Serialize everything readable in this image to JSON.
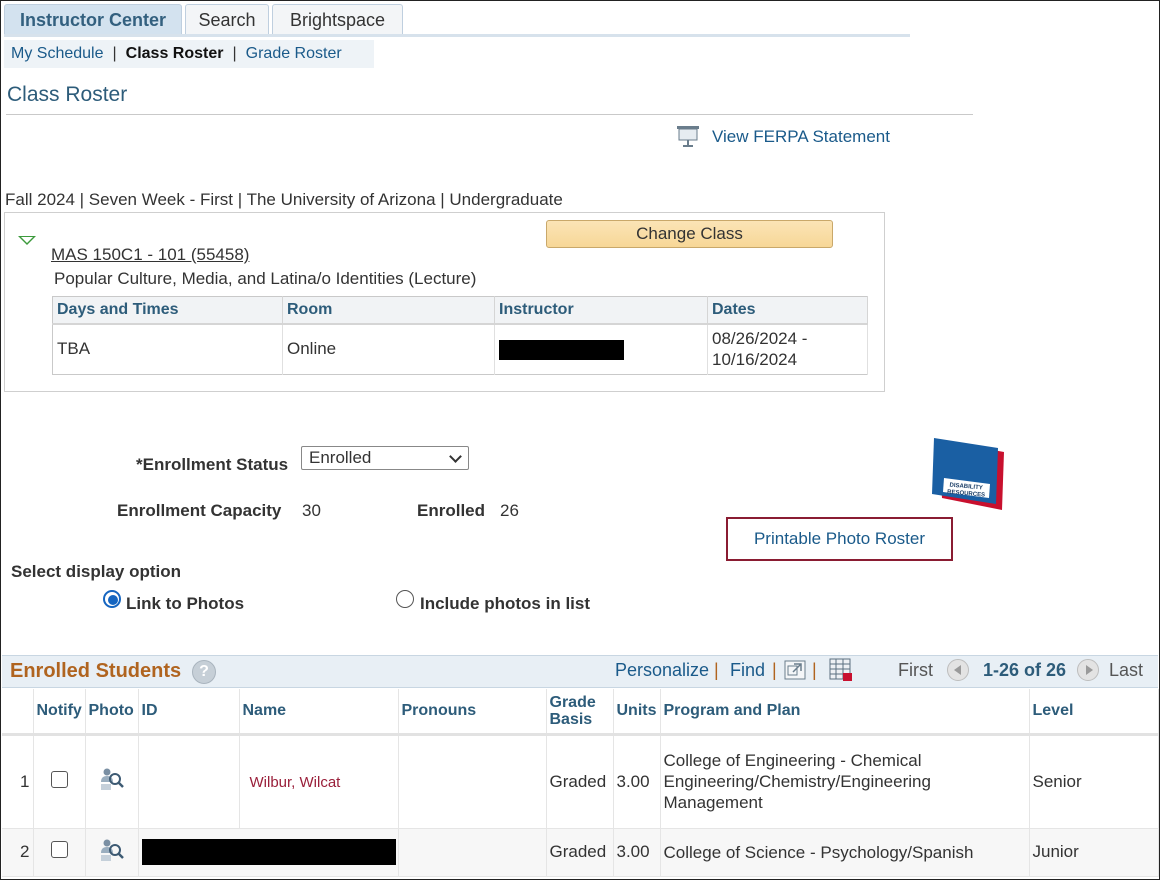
{
  "tabs": [
    {
      "label": "Instructor Center",
      "active": true
    },
    {
      "label": "Search",
      "active": false
    },
    {
      "label": "Brightspace",
      "active": false
    }
  ],
  "subnav": {
    "my_schedule": "My Schedule",
    "class_roster": "Class Roster",
    "grade_roster": "Grade Roster",
    "separator": "|"
  },
  "page_title": "Class Roster",
  "ferpa_link": "View FERPA Statement",
  "term_line": "Fall 2024 | Seven Week - First | The University of Arizona | Undergraduate",
  "change_class_label": "Change Class",
  "class": {
    "code": "MAS 150C1 - 101 (55458)",
    "description": "Popular Culture, Media, and Latina/o Identities (Lecture)",
    "headers": [
      "Days and Times",
      "Room",
      "Instructor",
      "Dates"
    ],
    "days_times": "TBA",
    "room": "Online",
    "dates_start": "08/26/2024 -",
    "dates_end": "10/16/2024"
  },
  "enrollment": {
    "status_label": "*Enrollment Status",
    "status_value": "Enrolled",
    "capacity_label": "Enrollment Capacity",
    "capacity_value": "30",
    "enrolled_label": "Enrolled",
    "enrolled_value": "26"
  },
  "logo_text": {
    "line1": "DISABILITY",
    "line2": "RESOURCES"
  },
  "printable_photo_roster": "Printable Photo Roster",
  "display_option": {
    "label": "Select display option",
    "link_to_photos": "Link to Photos",
    "include_photos": "Include photos in list",
    "selected": "Link to Photos"
  },
  "grid": {
    "title": "Enrolled Students",
    "help": "?",
    "personalize": "Personalize",
    "find": "Find",
    "sep": "|",
    "first": "First",
    "range": "1-26 of 26",
    "last": "Last",
    "columns": [
      "Notify",
      "Photo",
      "ID",
      "Name",
      "Pronouns",
      "Grade Basis",
      "Units",
      "Program and Plan",
      "Level"
    ],
    "rows": [
      {
        "num": "1",
        "name": "Wilbur, Wilcat",
        "basis": "Graded",
        "units": "3.00",
        "program": "College of Engineering - Chemical Engineering/Chemistry/Engineering Management",
        "level": "Senior"
      },
      {
        "num": "2",
        "name": "",
        "basis": "Graded",
        "units": "3.00",
        "program": "College of Science - Psychology/Spanish",
        "level": "Junior"
      }
    ]
  },
  "colors": {
    "accent": "#2d5c7a",
    "link": "#1a5a8a",
    "grid_title": "#b0641f",
    "highlight_border": "#8a1c32",
    "name_link": "#9a1f3a"
  }
}
